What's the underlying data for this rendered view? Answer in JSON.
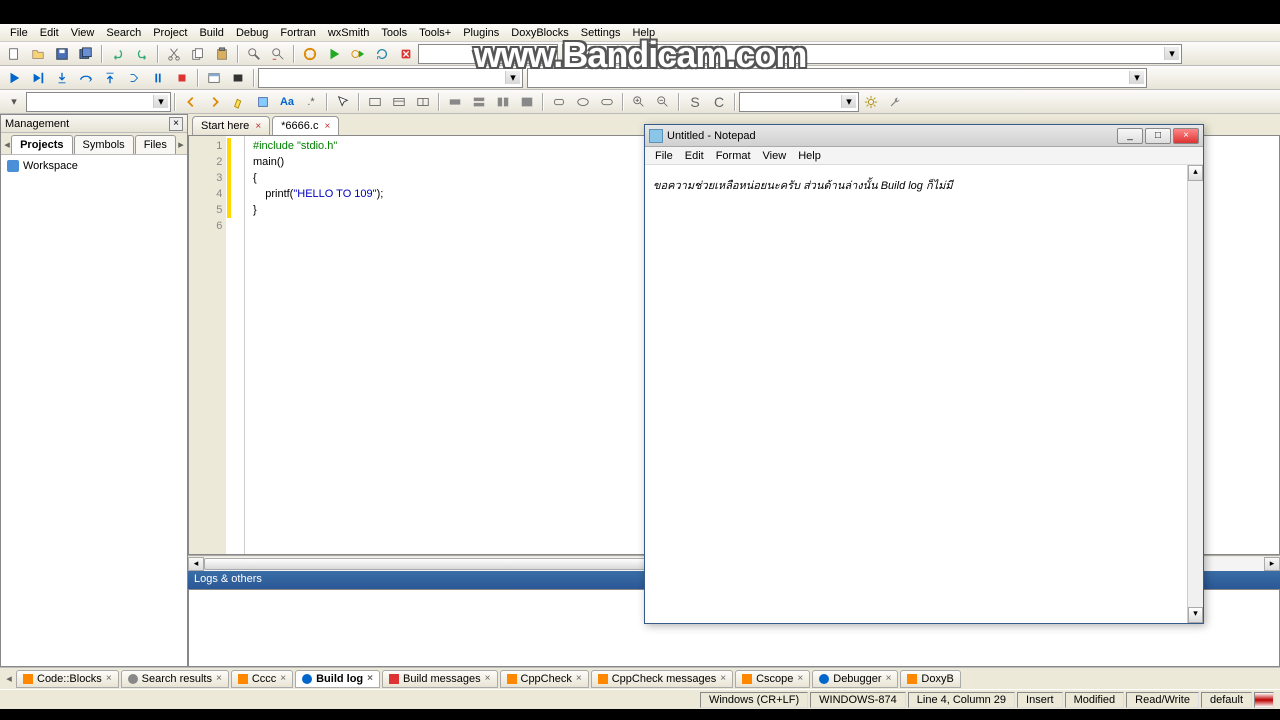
{
  "watermark": "www.Bandicam.com",
  "menubar": [
    "File",
    "Edit",
    "View",
    "Search",
    "Project",
    "Build",
    "Debug",
    "Fortran",
    "wxSmith",
    "Tools",
    "Tools+",
    "Plugins",
    "DoxyBlocks",
    "Settings",
    "Help"
  ],
  "sidebar": {
    "title": "Management",
    "tabs": [
      "Projects",
      "Symbols",
      "Files"
    ],
    "active_tab": 0,
    "tree_root": "Workspace"
  },
  "editor": {
    "tabs": [
      {
        "label": "Start here",
        "active": false
      },
      {
        "label": "*6666.c",
        "active": true
      }
    ],
    "line_numbers": [
      "1",
      "2",
      "3",
      "4",
      "5",
      "6"
    ],
    "code_lines": [
      {
        "pre": "",
        "str": "#include \"stdio.h\"",
        "cls": "kw-green"
      },
      {
        "pre": "main()",
        "cls": ""
      },
      {
        "pre": "{",
        "cls": ""
      },
      {
        "pre": "    printf(",
        "mid": "\"HELLO TO 109\"",
        "post": ");"
      },
      {
        "pre": "}",
        "cls": ""
      },
      {
        "pre": "",
        "cls": ""
      }
    ]
  },
  "logs_title": "Logs & others",
  "bottom_tabs": [
    {
      "label": "Code::Blocks"
    },
    {
      "label": "Search results"
    },
    {
      "label": "Cccc"
    },
    {
      "label": "Build log",
      "active": true
    },
    {
      "label": "Build messages"
    },
    {
      "label": "CppCheck"
    },
    {
      "label": "CppCheck messages"
    },
    {
      "label": "Cscope"
    },
    {
      "label": "Debugger"
    },
    {
      "label": "DoxyB"
    }
  ],
  "status": {
    "eol": "Windows (CR+LF)",
    "enc": "WINDOWS-874",
    "pos": "Line 4, Column 29",
    "ins": "Insert",
    "mod": "Modified",
    "rw": "Read/Write",
    "def": "default"
  },
  "notepad": {
    "title": "Untitled - Notepad",
    "menu": [
      "File",
      "Edit",
      "Format",
      "View",
      "Help"
    ],
    "content": "ขอความช่วยเหลือหน่อยนะครับ ส่วนด้านล่างนั้น Build log ก็ไม่มี"
  },
  "toolbar_text": {
    "S": "S",
    "C": "C"
  }
}
